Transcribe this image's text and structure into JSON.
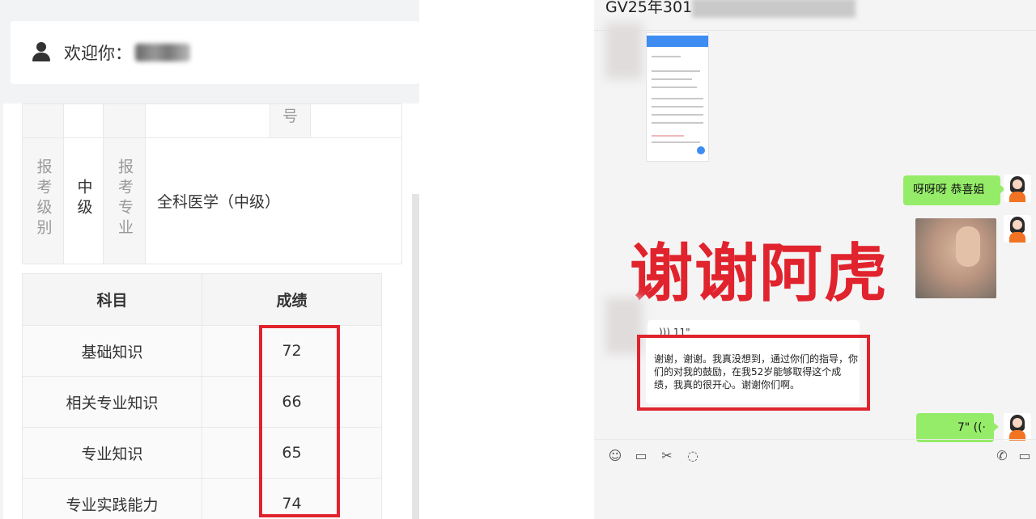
{
  "left_panel": {
    "welcome_label": "欢迎你：",
    "info_table": {
      "row_top_partial_label": "号",
      "exam_level_label": "报考级别",
      "exam_level_value": "中级",
      "exam_major_label": "报考专业",
      "exam_major_value": "全科医学（中级）"
    },
    "score_table": {
      "headers": [
        "科目",
        "成绩"
      ],
      "rows": [
        {
          "subject": "基础知识",
          "score": "72"
        },
        {
          "subject": "相关专业知识",
          "score": "66"
        },
        {
          "subject": "专业知识",
          "score": "65"
        },
        {
          "subject": "专业实践能力",
          "score": "74"
        }
      ]
    }
  },
  "right_panel": {
    "chat_title": "GV25年301",
    "bubble_text": "呀呀呀  恭喜姐",
    "overlay_caption": "谢谢阿虎",
    "voice_message_duration": "11\"",
    "voice_transcript": "谢谢，谢谢。我真没想到，通过你们的指导，你们的对我的鼓励，在我52岁能够取得这个成绩，我真的很开心。谢谢你们啊。",
    "voice_reply_duration": "7\"",
    "avatar_icon": "girl-avatar-icon",
    "toolbar_icons": [
      "emoji-icon",
      "folder-icon",
      "scissors-icon",
      "chat-bubble-icon",
      "phone-icon",
      "video-icon"
    ],
    "highlight_color": "#e0232d",
    "bubble_color": "#95ec69"
  }
}
